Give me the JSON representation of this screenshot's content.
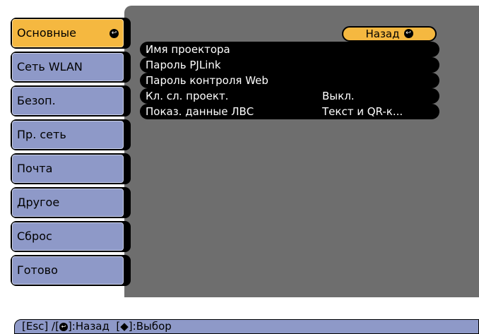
{
  "sidebar": {
    "items": [
      {
        "label": "Основные",
        "active": true
      },
      {
        "label": "Сеть WLAN",
        "active": false
      },
      {
        "label": "Безоп.",
        "active": false
      },
      {
        "label": "Пр. сеть",
        "active": false
      },
      {
        "label": "Почта",
        "active": false
      },
      {
        "label": "Другое",
        "active": false
      },
      {
        "label": "Сброс",
        "active": false
      },
      {
        "label": "Готово",
        "active": false
      }
    ]
  },
  "main": {
    "back_label": "Назад",
    "rows": [
      {
        "label": "Имя проектора",
        "value": ""
      },
      {
        "label": "Пароль PJLink",
        "value": ""
      },
      {
        "label": "Пароль контроля Web",
        "value": ""
      },
      {
        "label": "Кл. сл. проект.",
        "value": "Выкл."
      },
      {
        "label": "Показ. данные ЛВС",
        "value": "Текст и QR-к..."
      }
    ]
  },
  "footer": {
    "esc": "[Esc]",
    "sep1": " /[",
    "back": "]:Назад",
    "select_open": "  [",
    "updown": "◆",
    "select": "]:Выбор"
  },
  "colors": {
    "panel_bg": "#6e6e6e",
    "tab_bg": "#8e99c8",
    "active_bg": "#f5b840",
    "row_bg": "#000000"
  },
  "icons": {
    "enter": "enter-icon",
    "updown": "up-down-arrows-icon"
  }
}
